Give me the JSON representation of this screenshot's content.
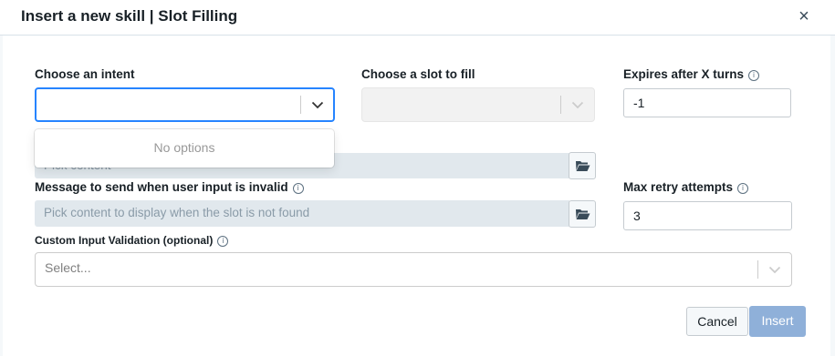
{
  "dialog": {
    "title": "Insert a new skill | Slot Filling",
    "close_symbol": "×"
  },
  "intent": {
    "label": "Choose an intent",
    "value": "",
    "menu_text": "No options"
  },
  "slot": {
    "label": "Choose a slot to fill",
    "value": ""
  },
  "expires": {
    "label": "Expires after X turns",
    "value": "-1"
  },
  "prompt_content": {
    "placeholder": "Pick content"
  },
  "invalid_message": {
    "label": "Message to send when user input is invalid",
    "placeholder": "Pick content to display when the slot is not found"
  },
  "max_retry": {
    "label": "Max retry attempts",
    "value": "3"
  },
  "custom_validation": {
    "label": "Custom Input Validation (optional)",
    "placeholder": "Select..."
  },
  "footer": {
    "cancel_label": "Cancel",
    "insert_label": "Insert"
  },
  "colors": {
    "focus_border": "#2684ff",
    "insert_button": "#8fb0d9",
    "content_bar": "#e1e8ed"
  },
  "icons": {
    "info": "info-icon",
    "chevron": "chevron-down-icon",
    "folder": "folder-open-icon",
    "close": "close-icon"
  }
}
